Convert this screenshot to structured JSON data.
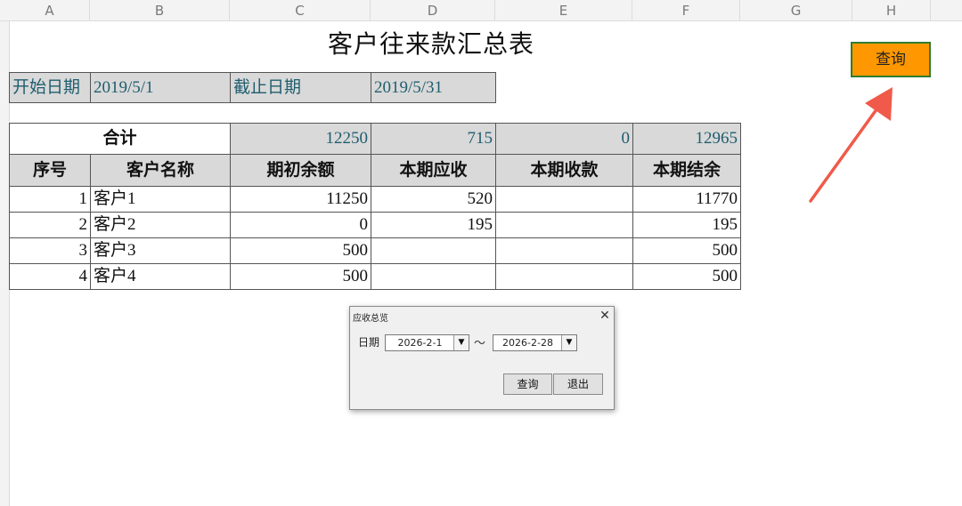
{
  "columns": [
    "A",
    "B",
    "C",
    "D",
    "E",
    "F",
    "G",
    "H"
  ],
  "sheet": {
    "title": "客户往来款汇总表",
    "start_label": "开始日期",
    "start_date": "2019/5/1",
    "end_label": "截止日期",
    "end_date": "2019/5/31",
    "total_label": "合计",
    "totals": [
      "12250",
      "715",
      "0",
      "12965"
    ],
    "headers": [
      "序号",
      "客户名称",
      "期初余额",
      "本期应收",
      "本期收款",
      "本期结余"
    ],
    "rows": [
      [
        "1",
        "客户1",
        "11250",
        "520",
        "",
        "11770"
      ],
      [
        "2",
        "客户2",
        "0",
        "195",
        "",
        "195"
      ],
      [
        "3",
        "客户3",
        "500",
        "",
        "",
        "500"
      ],
      [
        "4",
        "客户4",
        "500",
        "",
        "",
        "500"
      ]
    ]
  },
  "query_button": "查询",
  "colors": {
    "accent_button": "#ff9800",
    "button_border": "#2e7d32",
    "arrow": "#f05a4a",
    "header_fill": "#d9d9d9"
  },
  "dialog": {
    "title": "应收总览",
    "close_icon": "close-icon",
    "date_label": "日期",
    "from_date": "2026-2-1",
    "separator": "～",
    "to_date": "2026-2-28",
    "query_label": "查询",
    "exit_label": "退出"
  }
}
